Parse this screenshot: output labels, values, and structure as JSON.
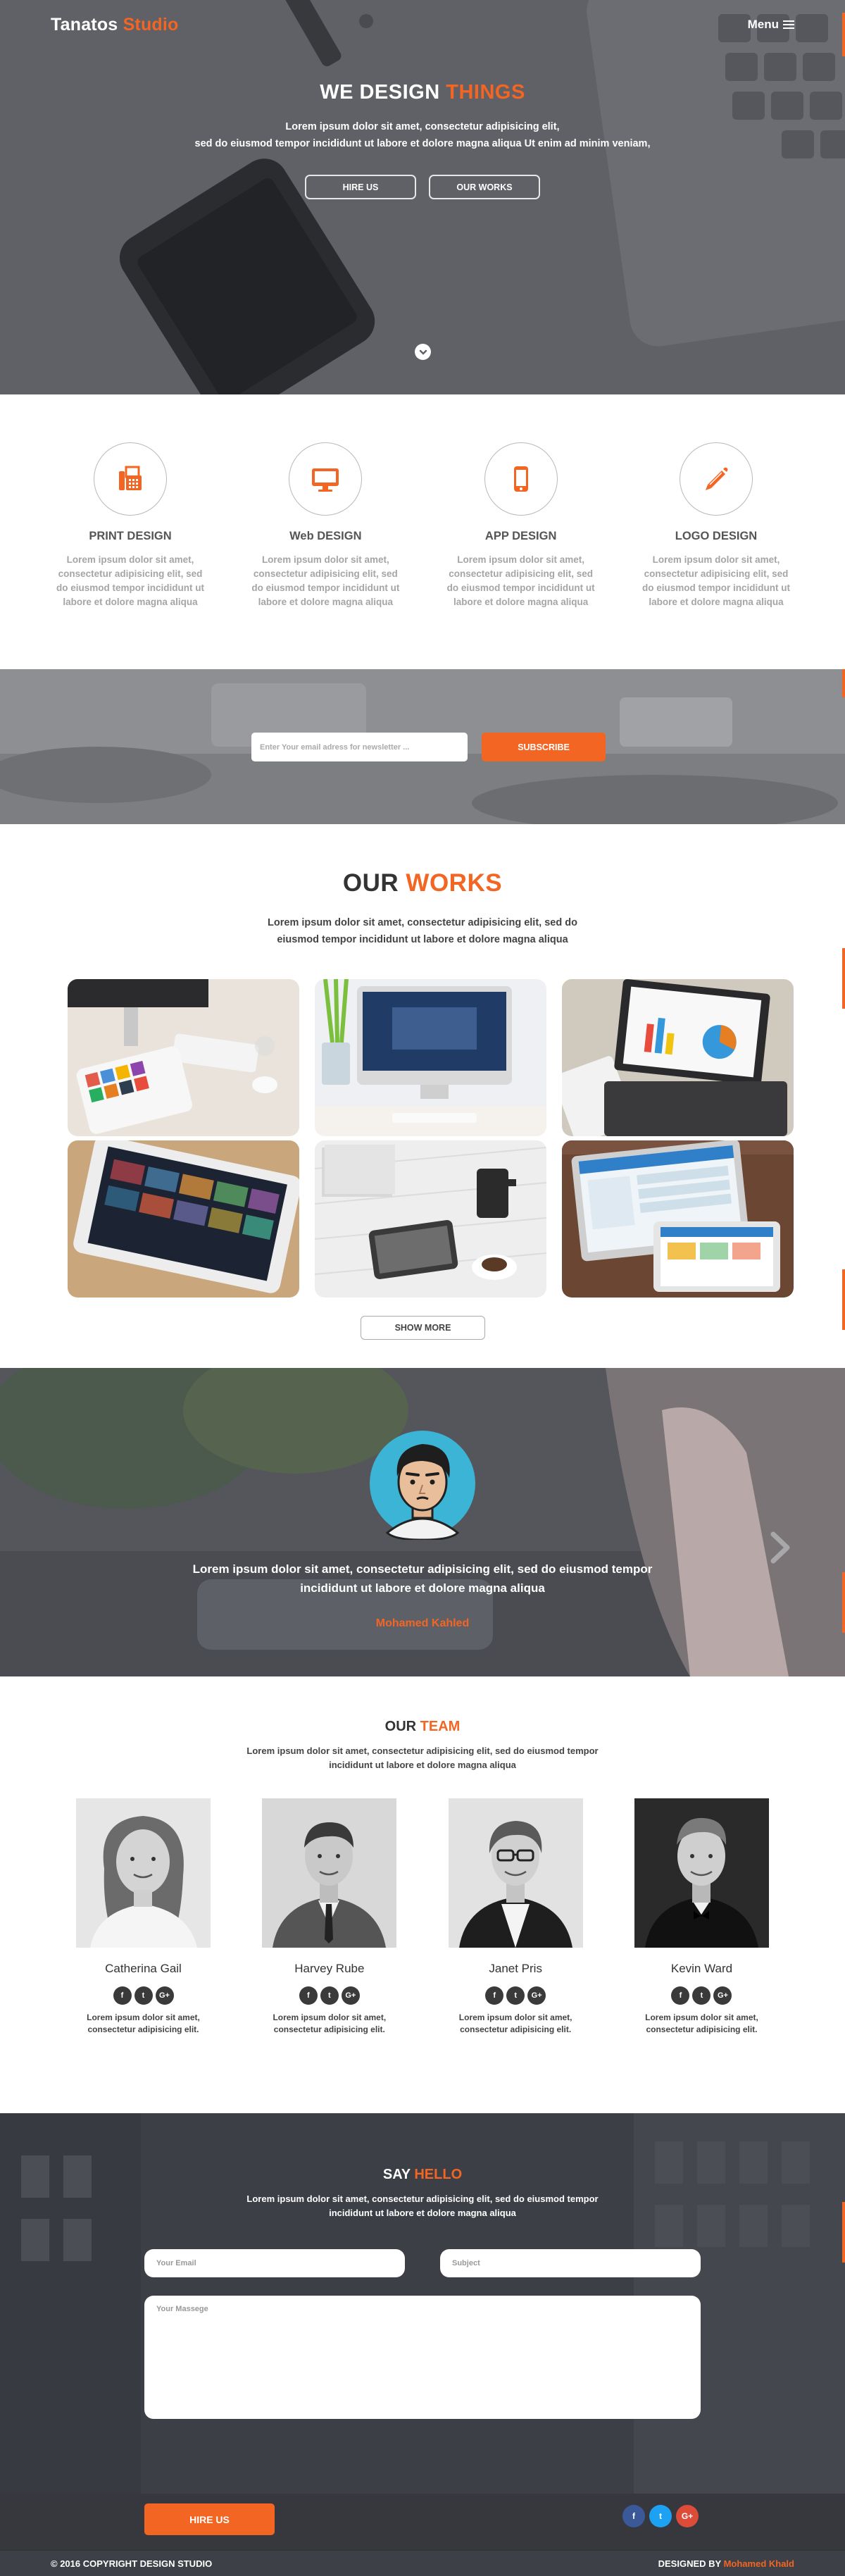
{
  "nav": {
    "brand_main": "Tanatos",
    "brand_accent": "Studio",
    "menu_label": "Menu"
  },
  "hero": {
    "title_main": "WE DESIGN",
    "title_accent": "THINGS",
    "line1": "Lorem ipsum dolor sit amet, consectetur adipisicing elit,",
    "line2": "sed do eiusmod tempor incididunt ut labore et dolore magna aliqua Ut enim ad minim veniam,",
    "btn_hire": "HIRE US",
    "btn_works": "OUR WORKS"
  },
  "services": [
    {
      "title": "PRINT DESIGN",
      "icon": "fax-icon",
      "line1": "Lorem ipsum dolor sit amet,",
      "line2": "consectetur adipisicing elit, sed",
      "line3": "do eiusmod tempor incididunt ut",
      "line4": "labore et dolore magna aliqua"
    },
    {
      "title": "Web DESIGN",
      "icon": "desktop-icon",
      "line1": "Lorem ipsum dolor sit amet,",
      "line2": "consectetur adipisicing elit, sed",
      "line3": "do eiusmod tempor incididunt ut",
      "line4": "labore et dolore magna aliqua"
    },
    {
      "title": "APP DESIGN",
      "icon": "mobile-icon",
      "line1": "Lorem ipsum dolor sit amet,",
      "line2": "consectetur adipisicing elit, sed",
      "line3": "do eiusmod tempor incididunt ut",
      "line4": "labore et dolore magna aliqua"
    },
    {
      "title": "LOGO DESIGN",
      "icon": "pencil-icon",
      "line1": "Lorem ipsum dolor sit amet,",
      "line2": "consectetur adipisicing elit, sed",
      "line3": "do eiusmod tempor incididunt ut",
      "line4": "labore et dolore magna aliqua"
    }
  ],
  "newsletter": {
    "placeholder": "Enter Your email adress for newsletter ...",
    "button": "SUBSCRIBE"
  },
  "works": {
    "title_main": "OUR",
    "title_accent": "WORKS",
    "line1": "Lorem ipsum dolor sit amet, consectetur adipisicing elit, sed do",
    "line2": "eiusmod tempor incididunt ut labore et dolore magna aliqua",
    "show_more": "SHOW MORE"
  },
  "testimonial": {
    "line1": "Lorem ipsum dolor sit amet, consectetur adipisicing elit, sed do eiusmod tempor",
    "line2": "incididunt ut labore et dolore magna aliqua",
    "author": "Mohamed Kahled"
  },
  "team": {
    "title_main": "OUR",
    "title_accent": "TEAM",
    "line1": "Lorem ipsum dolor sit amet, consectetur adipisicing elit, sed do eiusmod tempor",
    "line2": "incididunt ut labore et dolore magna aliqua",
    "members": [
      {
        "name": "Catherina Gail",
        "line1": "Lorem ipsum dolor sit amet,",
        "line2": "consectetur adipisicing elit."
      },
      {
        "name": "Harvey Rube",
        "line1": "Lorem ipsum dolor sit amet,",
        "line2": "consectetur adipisicing elit."
      },
      {
        "name": "Janet Pris",
        "line1": "Lorem ipsum dolor sit amet,",
        "line2": "consectetur adipisicing elit."
      },
      {
        "name": "Kevin Ward",
        "line1": "Lorem ipsum dolor sit amet,",
        "line2": "consectetur adipisicing elit."
      }
    ],
    "social": {
      "facebook": "f",
      "twitter": "t",
      "google": "G+"
    }
  },
  "contact": {
    "title_main": "SAY",
    "title_accent": "HELLO",
    "line1": "Lorem ipsum dolor sit amet, consectetur adipisicing elit, sed do eiusmod tempor",
    "line2": "incididunt ut labore et dolore magna aliqua",
    "email_placeholder": "Your Email",
    "subject_placeholder": "Subject",
    "message_placeholder": "Your Massege",
    "button": "HIRE US",
    "social": {
      "facebook": "f",
      "twitter": "t",
      "google": "G+"
    }
  },
  "footer": {
    "copyright": "© 2016 COPYRIGHT DESIGN STUDIO",
    "designed_by": "DESIGNED BY",
    "designer": "Mohamed Khald"
  },
  "colors": {
    "accent": "#f26522",
    "dark": "#3e4047",
    "facebook": "#3b5998",
    "twitter": "#1da1f2",
    "google": "#dd4b39"
  }
}
